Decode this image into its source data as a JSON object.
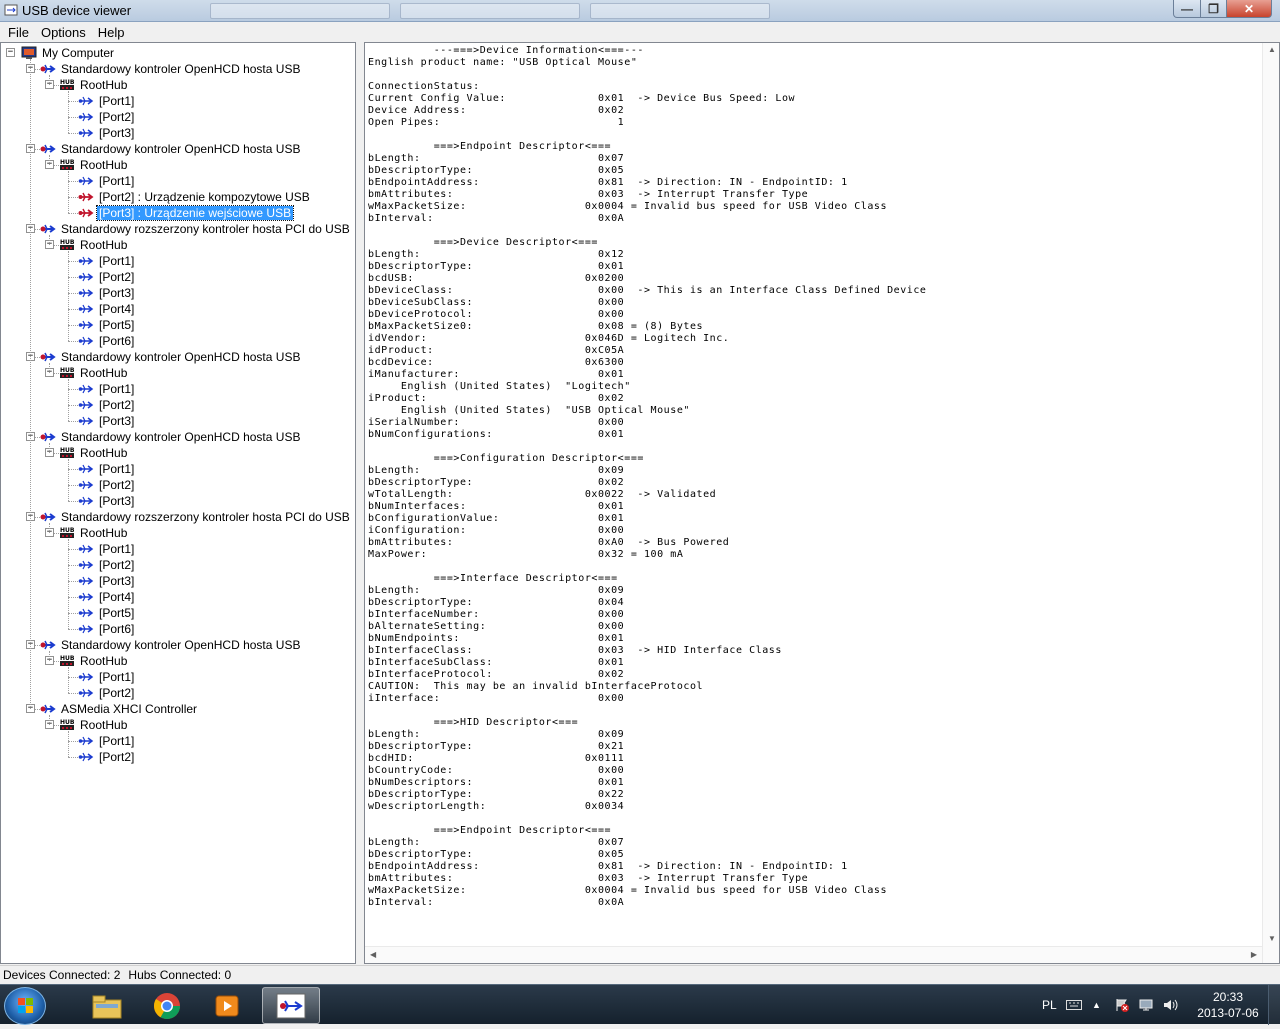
{
  "window": {
    "title": "USB device viewer",
    "min_glyph": "—",
    "max_glyph": "❐",
    "close_glyph": "✕"
  },
  "menu": [
    "File",
    "Options",
    "Help"
  ],
  "tree": [
    {
      "label": "My Computer",
      "level": 0,
      "icon": "computer-icon",
      "expander": "−"
    },
    {
      "label": "Standardowy kontroler OpenHCD hosta USB",
      "level": 1,
      "icon": "usb-controller-icon",
      "expander": "−"
    },
    {
      "label": "RootHub",
      "level": 2,
      "icon": "hub-icon",
      "expander": "−"
    },
    {
      "label": "[Port1]",
      "level": 3,
      "icon": "usb-port-icon"
    },
    {
      "label": "[Port2]",
      "level": 3,
      "icon": "usb-port-icon"
    },
    {
      "label": "[Port3]",
      "level": 3,
      "icon": "usb-port-icon"
    },
    {
      "label": "Standardowy kontroler OpenHCD hosta USB",
      "level": 1,
      "icon": "usb-controller-icon",
      "expander": "−"
    },
    {
      "label": "RootHub",
      "level": 2,
      "icon": "hub-icon",
      "expander": "−"
    },
    {
      "label": "[Port1]",
      "level": 3,
      "icon": "usb-port-icon"
    },
    {
      "label": "[Port2]  :  Urządzenie kompozytowe USB",
      "level": 3,
      "icon": "usb-device-icon"
    },
    {
      "label": "[Port3]  :  Urządzenie wejściowe USB",
      "level": 3,
      "icon": "usb-device-icon",
      "selected": true
    },
    {
      "label": "Standardowy rozszerzony kontroler hosta PCI do USB",
      "level": 1,
      "icon": "usb-controller-icon",
      "expander": "−"
    },
    {
      "label": "RootHub",
      "level": 2,
      "icon": "hub-icon",
      "expander": "−"
    },
    {
      "label": "[Port1]",
      "level": 3,
      "icon": "usb-port-icon"
    },
    {
      "label": "[Port2]",
      "level": 3,
      "icon": "usb-port-icon"
    },
    {
      "label": "[Port3]",
      "level": 3,
      "icon": "usb-port-icon"
    },
    {
      "label": "[Port4]",
      "level": 3,
      "icon": "usb-port-icon"
    },
    {
      "label": "[Port5]",
      "level": 3,
      "icon": "usb-port-icon"
    },
    {
      "label": "[Port6]",
      "level": 3,
      "icon": "usb-port-icon"
    },
    {
      "label": "Standardowy kontroler OpenHCD hosta USB",
      "level": 1,
      "icon": "usb-controller-icon",
      "expander": "−"
    },
    {
      "label": "RootHub",
      "level": 2,
      "icon": "hub-icon",
      "expander": "−"
    },
    {
      "label": "[Port1]",
      "level": 3,
      "icon": "usb-port-icon"
    },
    {
      "label": "[Port2]",
      "level": 3,
      "icon": "usb-port-icon"
    },
    {
      "label": "[Port3]",
      "level": 3,
      "icon": "usb-port-icon"
    },
    {
      "label": "Standardowy kontroler OpenHCD hosta USB",
      "level": 1,
      "icon": "usb-controller-icon",
      "expander": "−"
    },
    {
      "label": "RootHub",
      "level": 2,
      "icon": "hub-icon",
      "expander": "−"
    },
    {
      "label": "[Port1]",
      "level": 3,
      "icon": "usb-port-icon"
    },
    {
      "label": "[Port2]",
      "level": 3,
      "icon": "usb-port-icon"
    },
    {
      "label": "[Port3]",
      "level": 3,
      "icon": "usb-port-icon"
    },
    {
      "label": "Standardowy rozszerzony kontroler hosta PCI do USB",
      "level": 1,
      "icon": "usb-controller-icon",
      "expander": "−"
    },
    {
      "label": "RootHub",
      "level": 2,
      "icon": "hub-icon",
      "expander": "−"
    },
    {
      "label": "[Port1]",
      "level": 3,
      "icon": "usb-port-icon"
    },
    {
      "label": "[Port2]",
      "level": 3,
      "icon": "usb-port-icon"
    },
    {
      "label": "[Port3]",
      "level": 3,
      "icon": "usb-port-icon"
    },
    {
      "label": "[Port4]",
      "level": 3,
      "icon": "usb-port-icon"
    },
    {
      "label": "[Port5]",
      "level": 3,
      "icon": "usb-port-icon"
    },
    {
      "label": "[Port6]",
      "level": 3,
      "icon": "usb-port-icon"
    },
    {
      "label": "Standardowy kontroler OpenHCD hosta USB",
      "level": 1,
      "icon": "usb-controller-icon",
      "expander": "−"
    },
    {
      "label": "RootHub",
      "level": 2,
      "icon": "hub-icon",
      "expander": "−"
    },
    {
      "label": "[Port1]",
      "level": 3,
      "icon": "usb-port-icon"
    },
    {
      "label": "[Port2]",
      "level": 3,
      "icon": "usb-port-icon"
    },
    {
      "label": "ASMedia XHCI Controller",
      "level": 1,
      "icon": "usb-controller-icon",
      "expander": "−"
    },
    {
      "label": "RootHub",
      "level": 2,
      "icon": "hub-icon",
      "expander": "−"
    },
    {
      "label": "[Port1]",
      "level": 3,
      "icon": "usb-port-icon"
    },
    {
      "label": "[Port2]",
      "level": 3,
      "icon": "usb-port-icon"
    }
  ],
  "detail_lines": [
    "          ---===>Device Information<===---",
    "English product name: \"USB Optical Mouse\"",
    "",
    "ConnectionStatus:",
    "Current Config Value:              0x01  -> Device Bus Speed: Low",
    "Device Address:                    0x02",
    "Open Pipes:                           1",
    "",
    "          ===>Endpoint Descriptor<===",
    "bLength:                           0x07",
    "bDescriptorType:                   0x05",
    "bEndpointAddress:                  0x81  -> Direction: IN - EndpointID: 1",
    "bmAttributes:                      0x03  -> Interrupt Transfer Type",
    "wMaxPacketSize:                  0x0004 = Invalid bus speed for USB Video Class",
    "bInterval:                         0x0A",
    "",
    "          ===>Device Descriptor<===",
    "bLength:                           0x12",
    "bDescriptorType:                   0x01",
    "bcdUSB:                          0x0200",
    "bDeviceClass:                      0x00  -> This is an Interface Class Defined Device",
    "bDeviceSubClass:                   0x00",
    "bDeviceProtocol:                   0x00",
    "bMaxPacketSize0:                   0x08 = (8) Bytes",
    "idVendor:                        0x046D = Logitech Inc.",
    "idProduct:                       0xC05A",
    "bcdDevice:                       0x6300",
    "iManufacturer:                     0x01",
    "     English (United States)  \"Logitech\"",
    "iProduct:                          0x02",
    "     English (United States)  \"USB Optical Mouse\"",
    "iSerialNumber:                     0x00",
    "bNumConfigurations:                0x01",
    "",
    "          ===>Configuration Descriptor<===",
    "bLength:                           0x09",
    "bDescriptorType:                   0x02",
    "wTotalLength:                    0x0022  -> Validated",
    "bNumInterfaces:                    0x01",
    "bConfigurationValue:               0x01",
    "iConfiguration:                    0x00",
    "bmAttributes:                      0xA0  -> Bus Powered",
    "MaxPower:                          0x32 = 100 mA",
    "",
    "          ===>Interface Descriptor<===",
    "bLength:                           0x09",
    "bDescriptorType:                   0x04",
    "bInterfaceNumber:                  0x00",
    "bAlternateSetting:                 0x00",
    "bNumEndpoints:                     0x01",
    "bInterfaceClass:                   0x03  -> HID Interface Class",
    "bInterfaceSubClass:                0x01",
    "bInterfaceProtocol:                0x02",
    "CAUTION:  This may be an invalid bInterfaceProtocol",
    "iInterface:                        0x00",
    "",
    "          ===>HID Descriptor<===",
    "bLength:                           0x09",
    "bDescriptorType:                   0x21",
    "bcdHID:                          0x0111",
    "bCountryCode:                      0x00",
    "bNumDescriptors:                   0x01",
    "bDescriptorType:                   0x22",
    "wDescriptorLength:               0x0034",
    "",
    "          ===>Endpoint Descriptor<===",
    "bLength:                           0x07",
    "bDescriptorType:                   0x05",
    "bEndpointAddress:                  0x81  -> Direction: IN - EndpointID: 1",
    "bmAttributes:                      0x03  -> Interrupt Transfer Type",
    "wMaxPacketSize:                  0x0004 = Invalid bus speed for USB Video Class",
    "bInterval:                         0x0A"
  ],
  "status": {
    "devices": "Devices Connected: 2",
    "hubs": "Hubs Connected: 0"
  },
  "taskbar": {
    "apps": [
      "start-orb",
      "explorer-icon",
      "chrome-icon",
      "media-player-icon",
      "usb-viewer-icon"
    ],
    "language": "PL",
    "time": "20:33",
    "date": "2013-07-06"
  },
  "colors": {
    "selection": "#3399ff",
    "usb_icon_blue": "#1c3ccf",
    "usb_icon_red": "#c0142c"
  }
}
